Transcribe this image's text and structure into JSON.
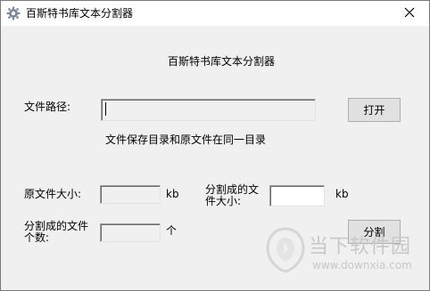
{
  "window": {
    "title": "百斯特书库文本分割器",
    "close_icon": "close-icon",
    "app_icon": "gear-icon"
  },
  "main": {
    "heading": "百斯特书库文本分割器",
    "file_path_label": "文件路径:",
    "file_path_value": "",
    "open_button": "打开",
    "save_note": "文件保存目录和原文件在同一目录",
    "original_size_label": "原文件大小:",
    "original_size_value": "",
    "original_size_unit": "kb",
    "split_size_label_line1": "分割成的文",
    "split_size_label_line2": "件大小:",
    "split_size_value": "",
    "split_size_unit": "kb",
    "split_count_label_line1": "分割成的文件",
    "split_count_label_line2": "个数:",
    "split_count_value": "",
    "split_count_unit": "个",
    "split_button": "分割"
  },
  "watermark": {
    "brand": "当下软件园",
    "url": "www.downxia.com"
  }
}
